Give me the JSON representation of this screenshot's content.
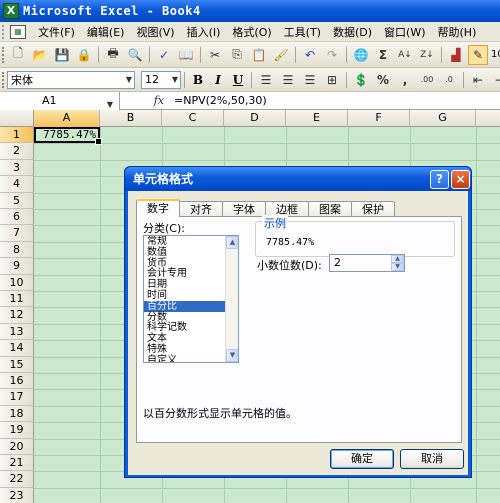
{
  "window": {
    "title": "Microsoft Excel - Book4",
    "app_icon_letter": "X"
  },
  "menu": {
    "items": [
      "文件(F)",
      "编辑(E)",
      "视图(V)",
      "插入(I)",
      "格式(O)",
      "工具(T)",
      "数据(D)",
      "窗口(W)",
      "帮助(H)"
    ]
  },
  "toolbar": {
    "font_name": "宋体",
    "font_size": "12",
    "bold": "B",
    "italic": "I",
    "underline": "U",
    "zoom": "100"
  },
  "formula_bar": {
    "cell_ref": "A1",
    "fx": "fx",
    "formula": "=NPV(2%,50,30)"
  },
  "sheet": {
    "columns": [
      "A",
      "B",
      "C",
      "D",
      "E",
      "F",
      "G"
    ],
    "rows": [
      "1",
      "2",
      "3",
      "4",
      "5",
      "6",
      "7",
      "8",
      "9",
      "10",
      "11",
      "12",
      "13",
      "14",
      "15",
      "16",
      "17",
      "18",
      "19",
      "20",
      "21",
      "22",
      "23"
    ],
    "a1_value": "7785.47%"
  },
  "dialog": {
    "title": "单元格格式",
    "help": "?",
    "close": "×",
    "tabs": [
      "数字",
      "对齐",
      "字体",
      "边框",
      "图案",
      "保护"
    ],
    "category_label": "分类(C):",
    "categories": [
      "常规",
      "数值",
      "货币",
      "会计专用",
      "日期",
      "时间",
      "百分比",
      "分数",
      "科学记数",
      "文本",
      "特殊",
      "自定义"
    ],
    "selected_category_index": 6,
    "sample_label": "示例",
    "sample_value": "7785.47%",
    "decimal_label": "小数位数(D):",
    "decimal_value": "2",
    "description": "以百分数形式显示单元格的值。",
    "ok": "确定",
    "cancel": "取消"
  }
}
